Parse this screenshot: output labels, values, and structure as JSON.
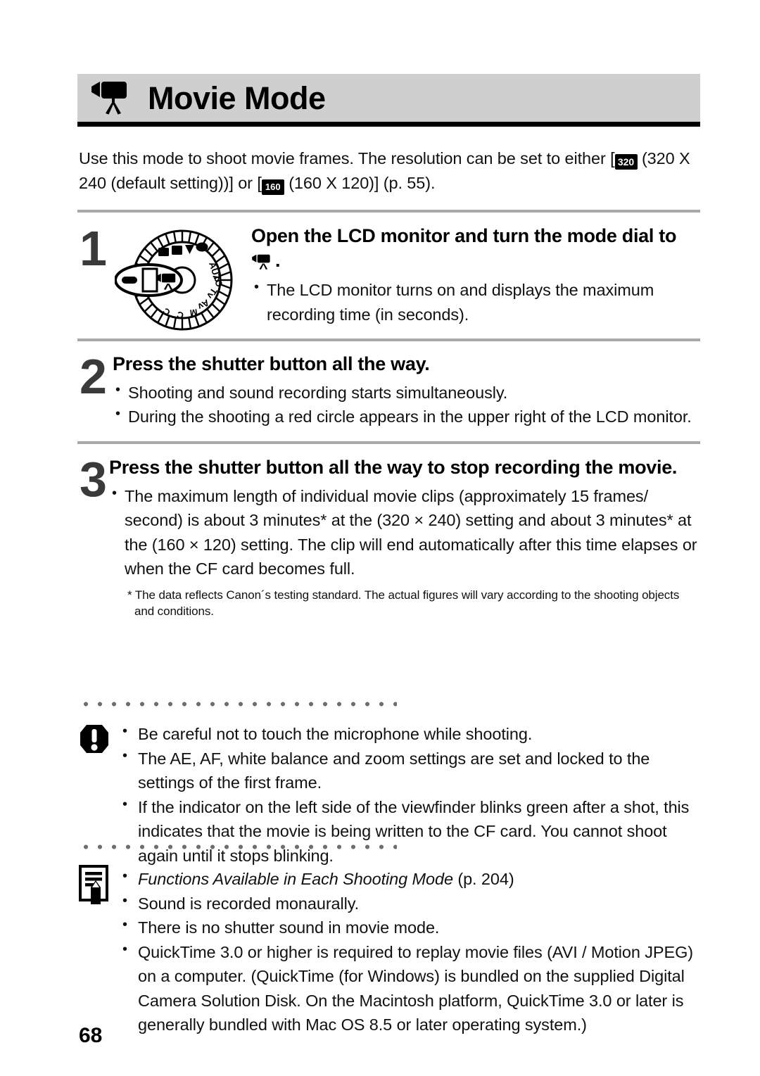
{
  "header": {
    "icon": "movie-camera-icon",
    "title": "Movie Mode"
  },
  "intro": {
    "part1": "Use this mode to shoot movie frames. The resolution can be set to either [",
    "icon1_label": "320",
    "part2": " (320 X 240 (default setting))] or [",
    "icon2_label": "160",
    "part3": " (160 X 120)] (p. 55)."
  },
  "steps": [
    {
      "number": "1",
      "illustration": "mode-dial-illustration",
      "heading_before_glyph": "Open the LCD monitor and turn the mode dial to ",
      "heading_after_glyph": ".",
      "bullets": [
        "The LCD monitor turns on and displays the maximum recording time (in seconds)."
      ]
    },
    {
      "number": "2",
      "heading": "Press the shutter button all the way.",
      "bullets": [
        "Shooting and sound recording starts simultaneously.",
        "During the shooting a red circle appears in the upper right of the LCD monitor."
      ]
    },
    {
      "number": "3",
      "heading": "Press the shutter button all the way to stop recording the movie.",
      "bullets": [
        "The maximum length of individual movie clips (approximately 15 frames/ second) is about 3 minutes* at the (320 × 240) setting and about 3 minutes* at the (160 × 120) setting. The clip will end automatically after this time elapses or when the CF card becomes full."
      ],
      "footnote": "* The data reflects Canon´s testing standard. The actual figures will vary according to the shooting objects and conditions."
    }
  ],
  "caution_block": {
    "icon": "warning-exclamation-icon",
    "items": [
      "Be careful not to touch the microphone while shooting.",
      "The AE, AF, white balance and zoom settings are set and locked to the settings of the first frame.",
      "If the indicator on the left side of the viewfinder blinks green after a shot, this indicates that the movie is being written to the CF card. You cannot shoot again until it stops blinking."
    ]
  },
  "note_block": {
    "icon": "note-pencil-icon",
    "item1_italic": "Functions Available in Each Shooting Mode",
    "item1_tail": " (p. 204)",
    "items": [
      "Sound is recorded monaurally.",
      "There is no shutter sound in movie mode.",
      "QuickTime 3.0 or higher is required to replay movie files (AVI / Motion JPEG) on a computer. (QuickTime (for Windows) is bundled on the supplied Digital Camera Solution Disk. On the Macintosh platform, QuickTime 3.0 or later is generally bundled with Mac OS 8.5 or later operating system.)"
    ]
  },
  "mode_dial": {
    "labels": [
      "AUTO",
      "P",
      "Tv",
      "Av",
      "M",
      "C"
    ],
    "highlighted_mode": "movie-mode"
  },
  "page_number": "68",
  "colors": {
    "header_band": "#cfcfcf",
    "header_underline": "#000000",
    "rule": "#a8a8a8",
    "dot": "#6d6d6d",
    "step_number": "#3a3a3a",
    "text": "#111111"
  }
}
